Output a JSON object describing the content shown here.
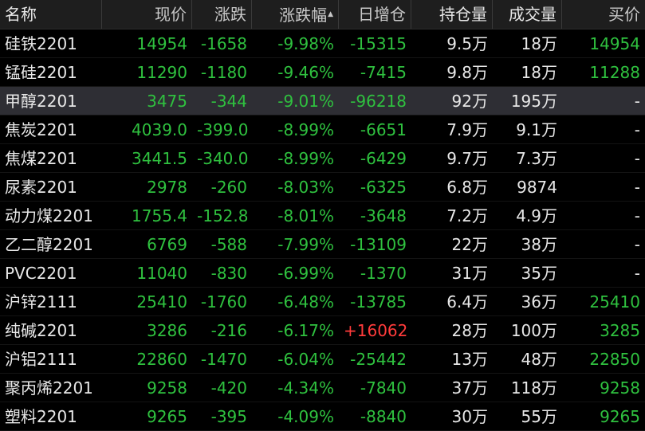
{
  "colors": {
    "down": "#2fc13f",
    "up": "#ff3b3b",
    "neutral": "#e8e8e8",
    "header_bg": "#1e1e1e",
    "selected_bg": "#2e2e34",
    "background": "#000000"
  },
  "header": {
    "name": "名称",
    "last": "现价",
    "change": "涨跌",
    "change_pct": "涨跌幅",
    "sort_arrow": "▲",
    "oi_change": "日增仓",
    "open_interest": "持仓量",
    "volume": "成交量",
    "bid": "买价"
  },
  "selected_row": 2,
  "rows": [
    {
      "name": "硅铁2201",
      "last": "14954",
      "change": "-1658",
      "change_pct": "-9.98%",
      "oi_change": "-15315",
      "oi_dir": "down",
      "open_interest": "9.5万",
      "volume": "18万",
      "bid": "14954",
      "bid_dir": "down"
    },
    {
      "name": "锰硅2201",
      "last": "11290",
      "change": "-1180",
      "change_pct": "-9.46%",
      "oi_change": "-7415",
      "oi_dir": "down",
      "open_interest": "9.8万",
      "volume": "18万",
      "bid": "11288",
      "bid_dir": "down"
    },
    {
      "name": "甲醇2201",
      "last": "3475",
      "change": "-344",
      "change_pct": "-9.01%",
      "oi_change": "-96218",
      "oi_dir": "down",
      "open_interest": "92万",
      "volume": "195万",
      "bid": "-",
      "bid_dir": "neutral"
    },
    {
      "name": "焦炭2201",
      "last": "4039.0",
      "change": "-399.0",
      "change_pct": "-8.99%",
      "oi_change": "-6651",
      "oi_dir": "down",
      "open_interest": "7.9万",
      "volume": "9.1万",
      "bid": "-",
      "bid_dir": "neutral"
    },
    {
      "name": "焦煤2201",
      "last": "3441.5",
      "change": "-340.0",
      "change_pct": "-8.99%",
      "oi_change": "-6429",
      "oi_dir": "down",
      "open_interest": "9.7万",
      "volume": "7.3万",
      "bid": "-",
      "bid_dir": "neutral"
    },
    {
      "name": "尿素2201",
      "last": "2978",
      "change": "-260",
      "change_pct": "-8.03%",
      "oi_change": "-6325",
      "oi_dir": "down",
      "open_interest": "6.8万",
      "volume": "9874",
      "bid": "-",
      "bid_dir": "neutral"
    },
    {
      "name": "动力煤2201",
      "last": "1755.4",
      "change": "-152.8",
      "change_pct": "-8.01%",
      "oi_change": "-3648",
      "oi_dir": "down",
      "open_interest": "7.2万",
      "volume": "4.9万",
      "bid": "-",
      "bid_dir": "neutral"
    },
    {
      "name": "乙二醇2201",
      "last": "6769",
      "change": "-588",
      "change_pct": "-7.99%",
      "oi_change": "-13109",
      "oi_dir": "down",
      "open_interest": "22万",
      "volume": "38万",
      "bid": "-",
      "bid_dir": "neutral"
    },
    {
      "name": "PVC2201",
      "last": "11040",
      "change": "-830",
      "change_pct": "-6.99%",
      "oi_change": "-1370",
      "oi_dir": "down",
      "open_interest": "31万",
      "volume": "35万",
      "bid": "-",
      "bid_dir": "neutral"
    },
    {
      "name": "沪锌2111",
      "last": "25410",
      "change": "-1760",
      "change_pct": "-6.48%",
      "oi_change": "-13785",
      "oi_dir": "down",
      "open_interest": "6.4万",
      "volume": "36万",
      "bid": "25410",
      "bid_dir": "down"
    },
    {
      "name": "纯碱2201",
      "last": "3286",
      "change": "-216",
      "change_pct": "-6.17%",
      "oi_change": "+16062",
      "oi_dir": "up",
      "open_interest": "28万",
      "volume": "100万",
      "bid": "3285",
      "bid_dir": "down"
    },
    {
      "name": "沪铝2111",
      "last": "22860",
      "change": "-1470",
      "change_pct": "-6.04%",
      "oi_change": "-25442",
      "oi_dir": "down",
      "open_interest": "13万",
      "volume": "48万",
      "bid": "22850",
      "bid_dir": "down"
    },
    {
      "name": "聚丙烯2201",
      "last": "9258",
      "change": "-420",
      "change_pct": "-4.34%",
      "oi_change": "-7840",
      "oi_dir": "down",
      "open_interest": "37万",
      "volume": "118万",
      "bid": "9258",
      "bid_dir": "down"
    },
    {
      "name": "塑料2201",
      "last": "9265",
      "change": "-395",
      "change_pct": "-4.09%",
      "oi_change": "-8840",
      "oi_dir": "down",
      "open_interest": "30万",
      "volume": "55万",
      "bid": "9265",
      "bid_dir": "down"
    }
  ]
}
